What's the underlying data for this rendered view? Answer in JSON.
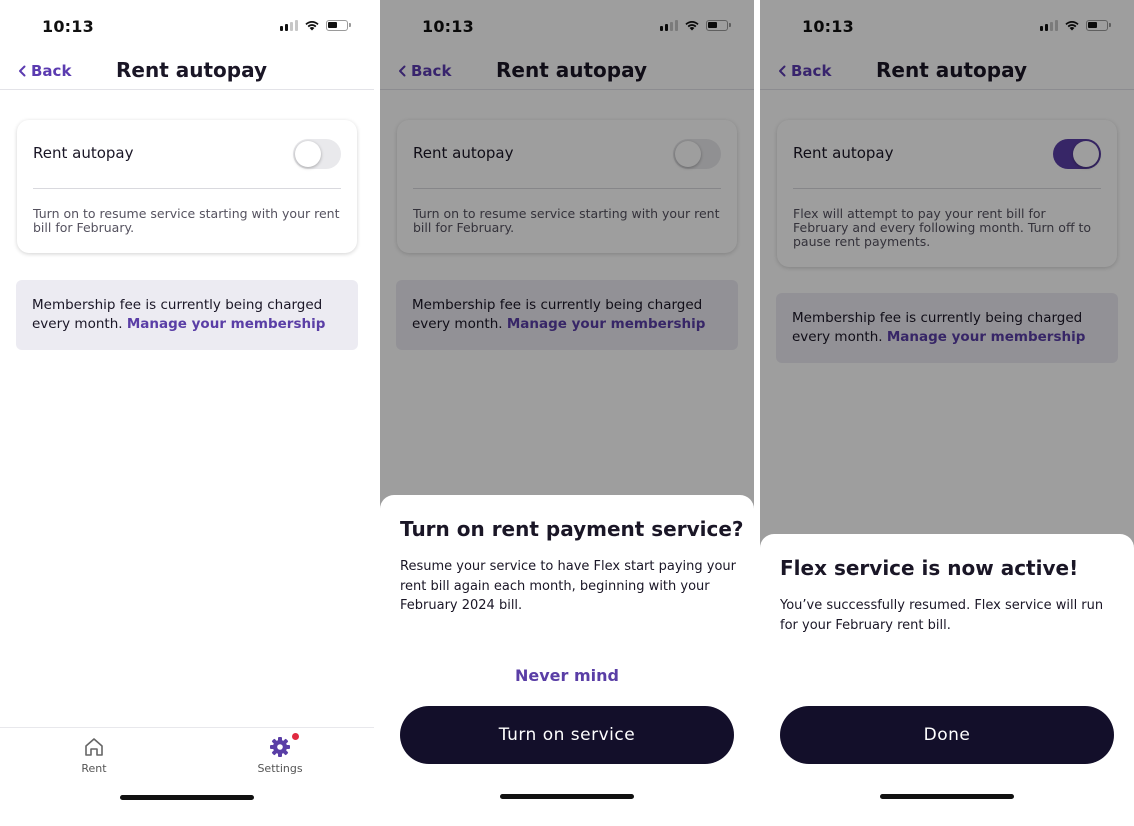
{
  "status": {
    "time": "10:13"
  },
  "nav": {
    "back_label": "Back",
    "title": "Rent autopay"
  },
  "card": {
    "label": "Rent autopay",
    "desc_off": "Turn on to resume service starting with your rent bill for February.",
    "desc_on": "Flex will attempt to pay your rent bill for February and every following month. Turn off to pause rent payments."
  },
  "membership": {
    "text": "Membership fee is currently being charged every month.",
    "link": "Manage your membership"
  },
  "tabbar": {
    "rent_label": "Rent",
    "settings_label": "Settings"
  },
  "confirm_sheet": {
    "title": "Turn on rent payment service?",
    "body": "Resume your service to have Flex start paying your rent bill again each month, beginning with your February 2024 bill.",
    "cancel_label": "Never mind",
    "confirm_label": "Turn on service"
  },
  "success_sheet": {
    "title": "Flex service is now active!",
    "body": "You’ve successfully resumed. Flex service will run for your February rent bill.",
    "done_label": "Done"
  },
  "colors": {
    "accent": "#5a3ea6",
    "dark_button": "#130f2a",
    "badge": "#e02940"
  }
}
